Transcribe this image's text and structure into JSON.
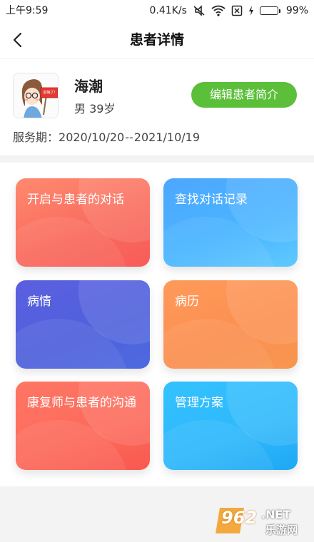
{
  "status_bar": {
    "time": "上午9:59",
    "network_speed": "0.41K/s",
    "battery": "99%",
    "battery_level": 0.99,
    "icons": [
      "mute-icon",
      "wifi-icon",
      "sim-off-icon",
      "charging-icon",
      "battery-icon"
    ]
  },
  "header": {
    "title": "患者详情",
    "back_icon": "chevron-left-icon"
  },
  "patient": {
    "name": "海潮",
    "gender_age": "男 39岁",
    "edit_button": "编辑患者简介",
    "service_label": "服务期：",
    "service_start": "2020/10/20",
    "service_sep": "--",
    "service_end": "2021/10/19",
    "avatar_sign_text": "后悔了!"
  },
  "tiles": [
    {
      "label": "开启与患者的对话",
      "color": "#f96a5d"
    },
    {
      "label": "查找对话记录",
      "color": "#4ab6ff"
    },
    {
      "label": "病情",
      "color": "#4f61db"
    },
    {
      "label": "病历",
      "color": "#fb8f50"
    },
    {
      "label": "康复师与患者的沟通",
      "color": "#fc6a5b"
    },
    {
      "label": "管理方案",
      "color": "#2fb8fb"
    }
  ],
  "watermark": {
    "number": "962",
    "suffix": ".NET",
    "name": "乐游网"
  },
  "colors": {
    "accent_green": "#5bbf3a",
    "background": "#f3f3f3"
  }
}
